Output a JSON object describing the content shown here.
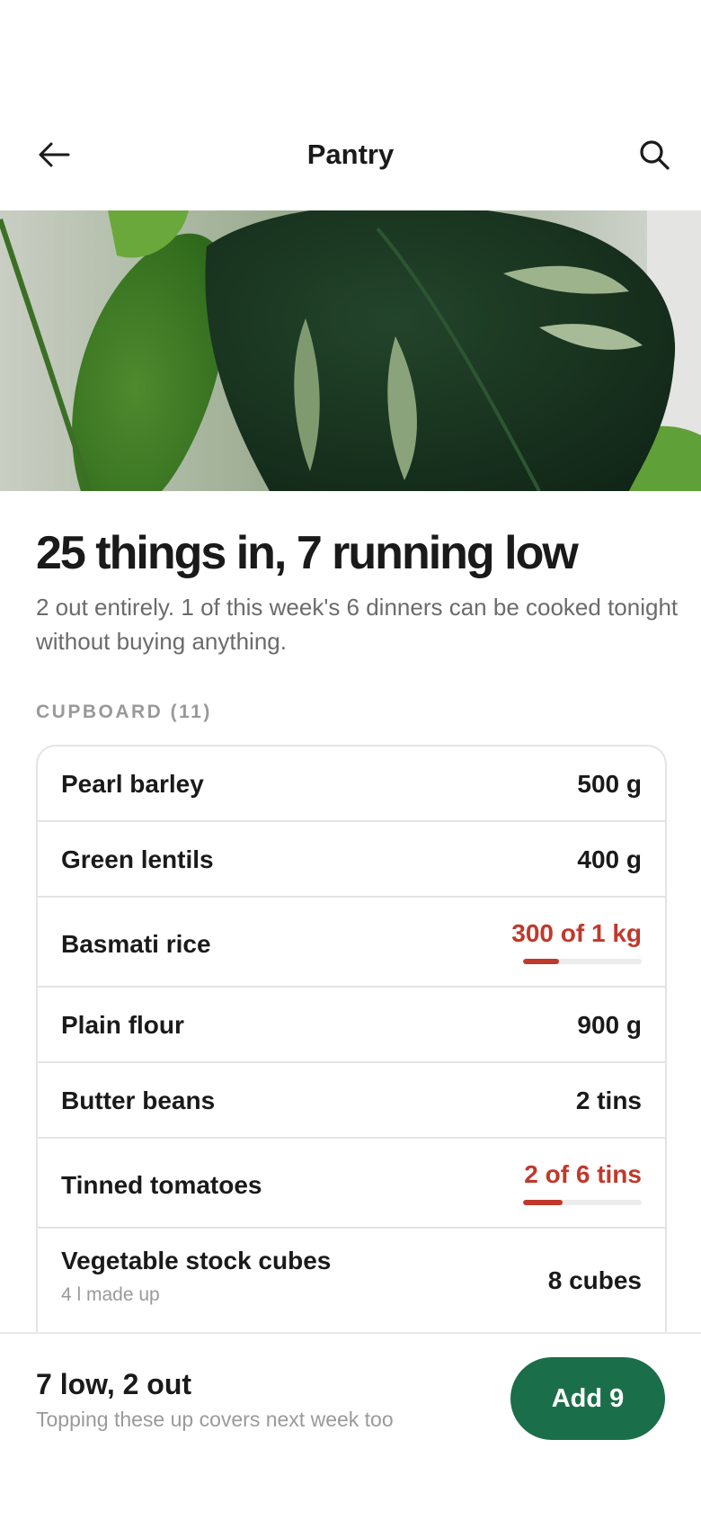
{
  "header": {
    "title": "Pantry",
    "back_icon": "arrow-left-icon",
    "search_icon": "search-icon"
  },
  "hero": {
    "description_icon": "monstera-photo"
  },
  "summary": {
    "headline": "25 things in, 7 running low",
    "subtext": "2 out entirely. 1 of this week's 6 dinners can be cooked tonight without buying anything."
  },
  "cupboard": {
    "label": "CUPBOARD (11)",
    "items": [
      {
        "name": "Pearl barley",
        "qty": "500 g",
        "note": "",
        "low": false,
        "level": null
      },
      {
        "name": "Green lentils",
        "qty": "400 g",
        "note": "",
        "low": false,
        "level": null
      },
      {
        "name": "Basmati rice",
        "qty": "300 of 1 kg",
        "note": "",
        "low": true,
        "level": 0.3
      },
      {
        "name": "Plain flour",
        "qty": "900 g",
        "note": "",
        "low": false,
        "level": null
      },
      {
        "name": "Butter beans",
        "qty": "2 tins",
        "note": "",
        "low": false,
        "level": null
      },
      {
        "name": "Tinned tomatoes",
        "qty": "2 of 6 tins",
        "note": "",
        "low": true,
        "level": 0.333
      },
      {
        "name": "Vegetable stock cubes",
        "qty": "8 cubes",
        "note": "4 l made up",
        "low": false,
        "level": null
      }
    ]
  },
  "footer": {
    "summary": "7 low, 2 out",
    "hint": "Topping these up covers next week too",
    "cta_label": "Add 9"
  },
  "colors": {
    "accent_green": "#1b6e4a",
    "low_red": "#c0392b"
  }
}
